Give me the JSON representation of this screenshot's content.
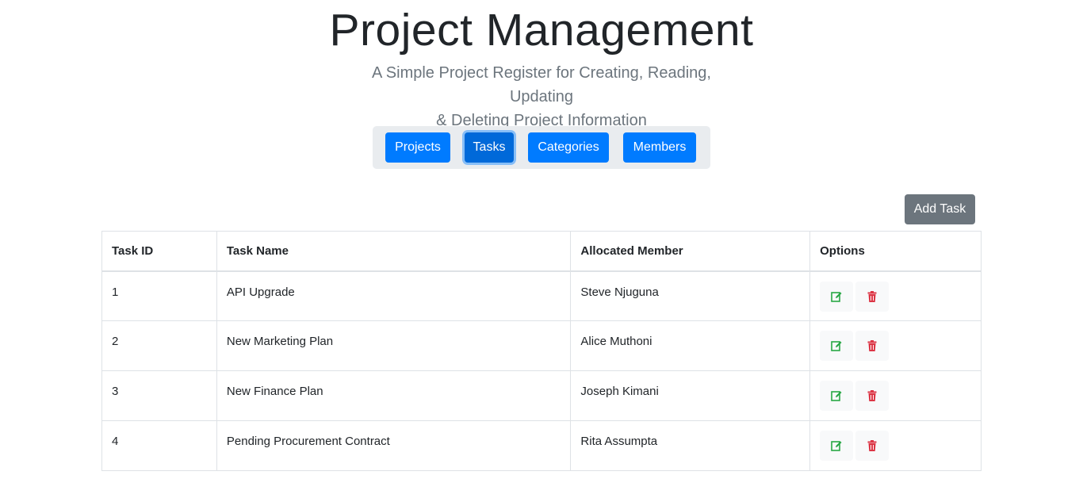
{
  "header": {
    "title": "Project Management",
    "subtitle_line1": "A Simple Project Register for Creating, Reading, Updating",
    "subtitle_line2": "& Deleting Project Information"
  },
  "nav": {
    "items": [
      {
        "label": "Projects",
        "active": false
      },
      {
        "label": "Tasks",
        "active": true
      },
      {
        "label": "Categories",
        "active": false
      },
      {
        "label": "Members",
        "active": false
      }
    ]
  },
  "actions": {
    "add_label": "Add Task"
  },
  "table": {
    "columns": [
      "Task ID",
      "Task Name",
      "Allocated Member",
      "Options"
    ],
    "rows": [
      {
        "id": "1",
        "name": "API Upgrade",
        "member": "Steve Njuguna"
      },
      {
        "id": "2",
        "name": "New Marketing Plan",
        "member": "Alice Muthoni"
      },
      {
        "id": "3",
        "name": "New Finance Plan",
        "member": "Joseph Kimani"
      },
      {
        "id": "4",
        "name": "Pending Procurement Contract",
        "member": "Rita Assumpta"
      }
    ],
    "row_icons": [
      "edit-icon",
      "trash-icon"
    ]
  },
  "colors": {
    "primary": "#007bff",
    "primary_active": "#0069d9",
    "secondary": "#6c757d",
    "edit": "#28a745",
    "delete": "#dc3545"
  }
}
